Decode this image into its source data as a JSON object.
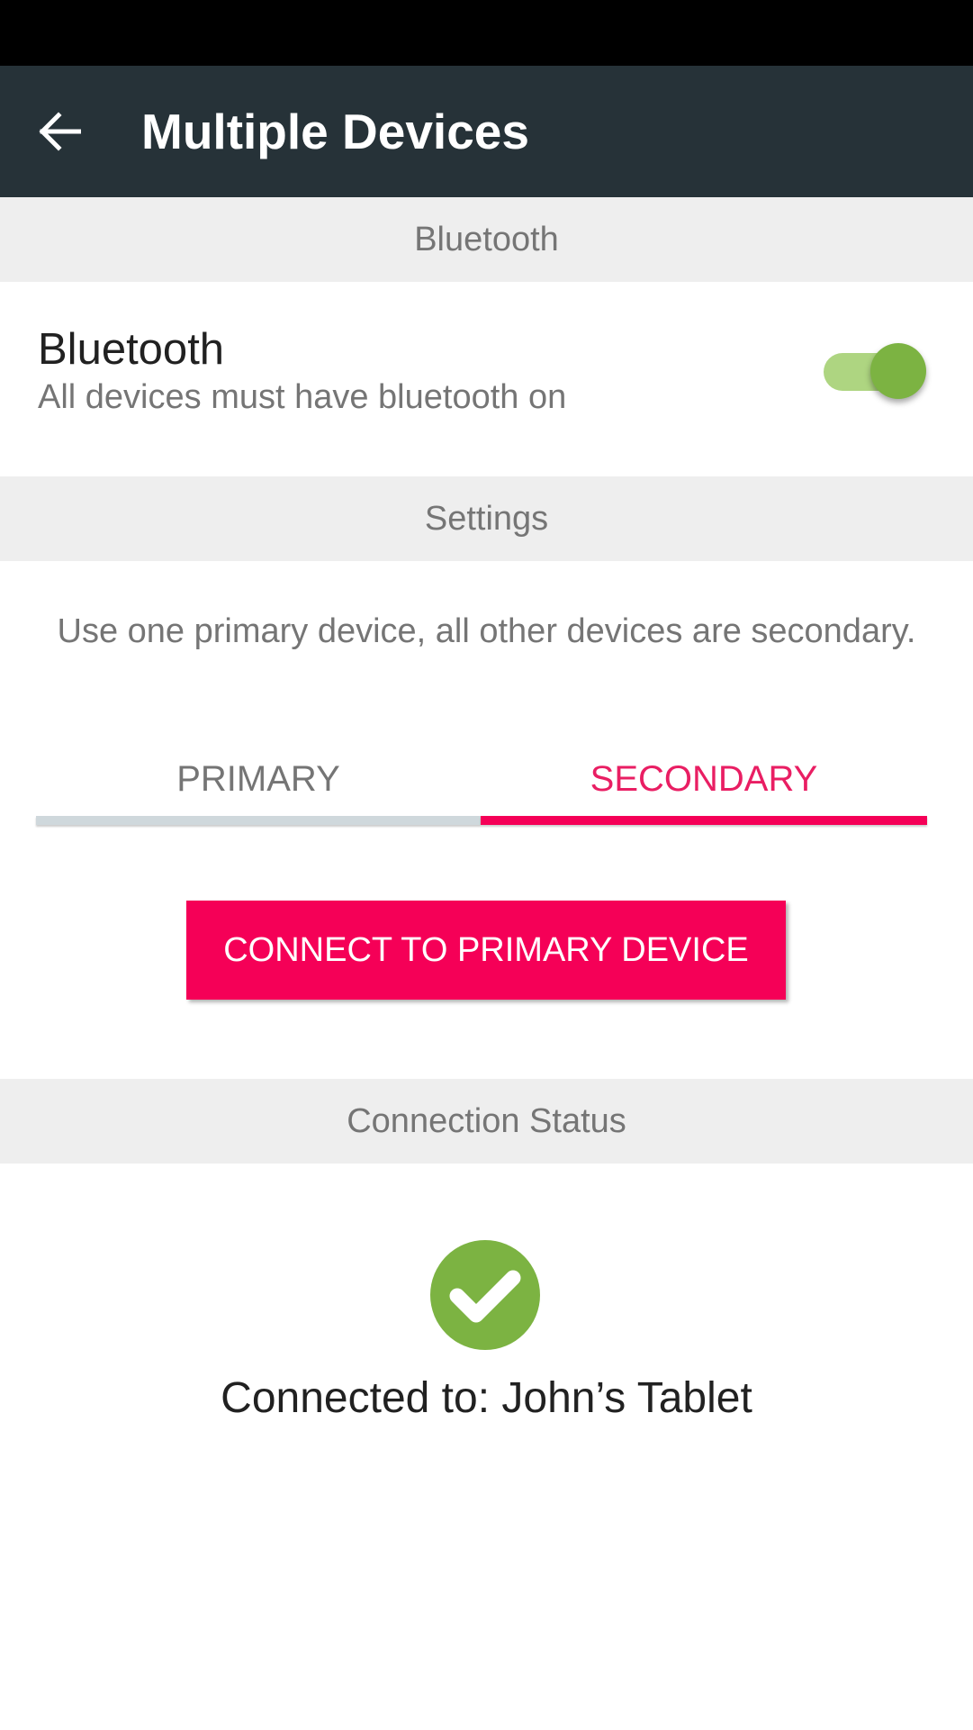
{
  "app_bar": {
    "title": "Multiple Devices",
    "background_color": "#263238",
    "back_icon": "arrow-left-icon"
  },
  "sections": {
    "bluetooth_header": "Bluetooth",
    "settings_header": "Settings",
    "connection_status_header": "Connection Status"
  },
  "bluetooth": {
    "title": "Bluetooth",
    "subtitle": "All devices must have bluetooth on",
    "toggle_on": true,
    "toggle_color": "#7cb342"
  },
  "settings": {
    "description": "Use one primary device, all other devices are secondary.",
    "tabs": [
      {
        "label": "PRIMARY",
        "selected": false
      },
      {
        "label": "SECONDARY",
        "selected": true
      }
    ],
    "accent_color": "#f50057"
  },
  "connect_button": {
    "label": "CONNECT TO PRIMARY DEVICE"
  },
  "connection_status": {
    "icon": "check-circle-icon",
    "icon_color": "#7cb342",
    "text": "Connected to: John’s Tablet"
  }
}
